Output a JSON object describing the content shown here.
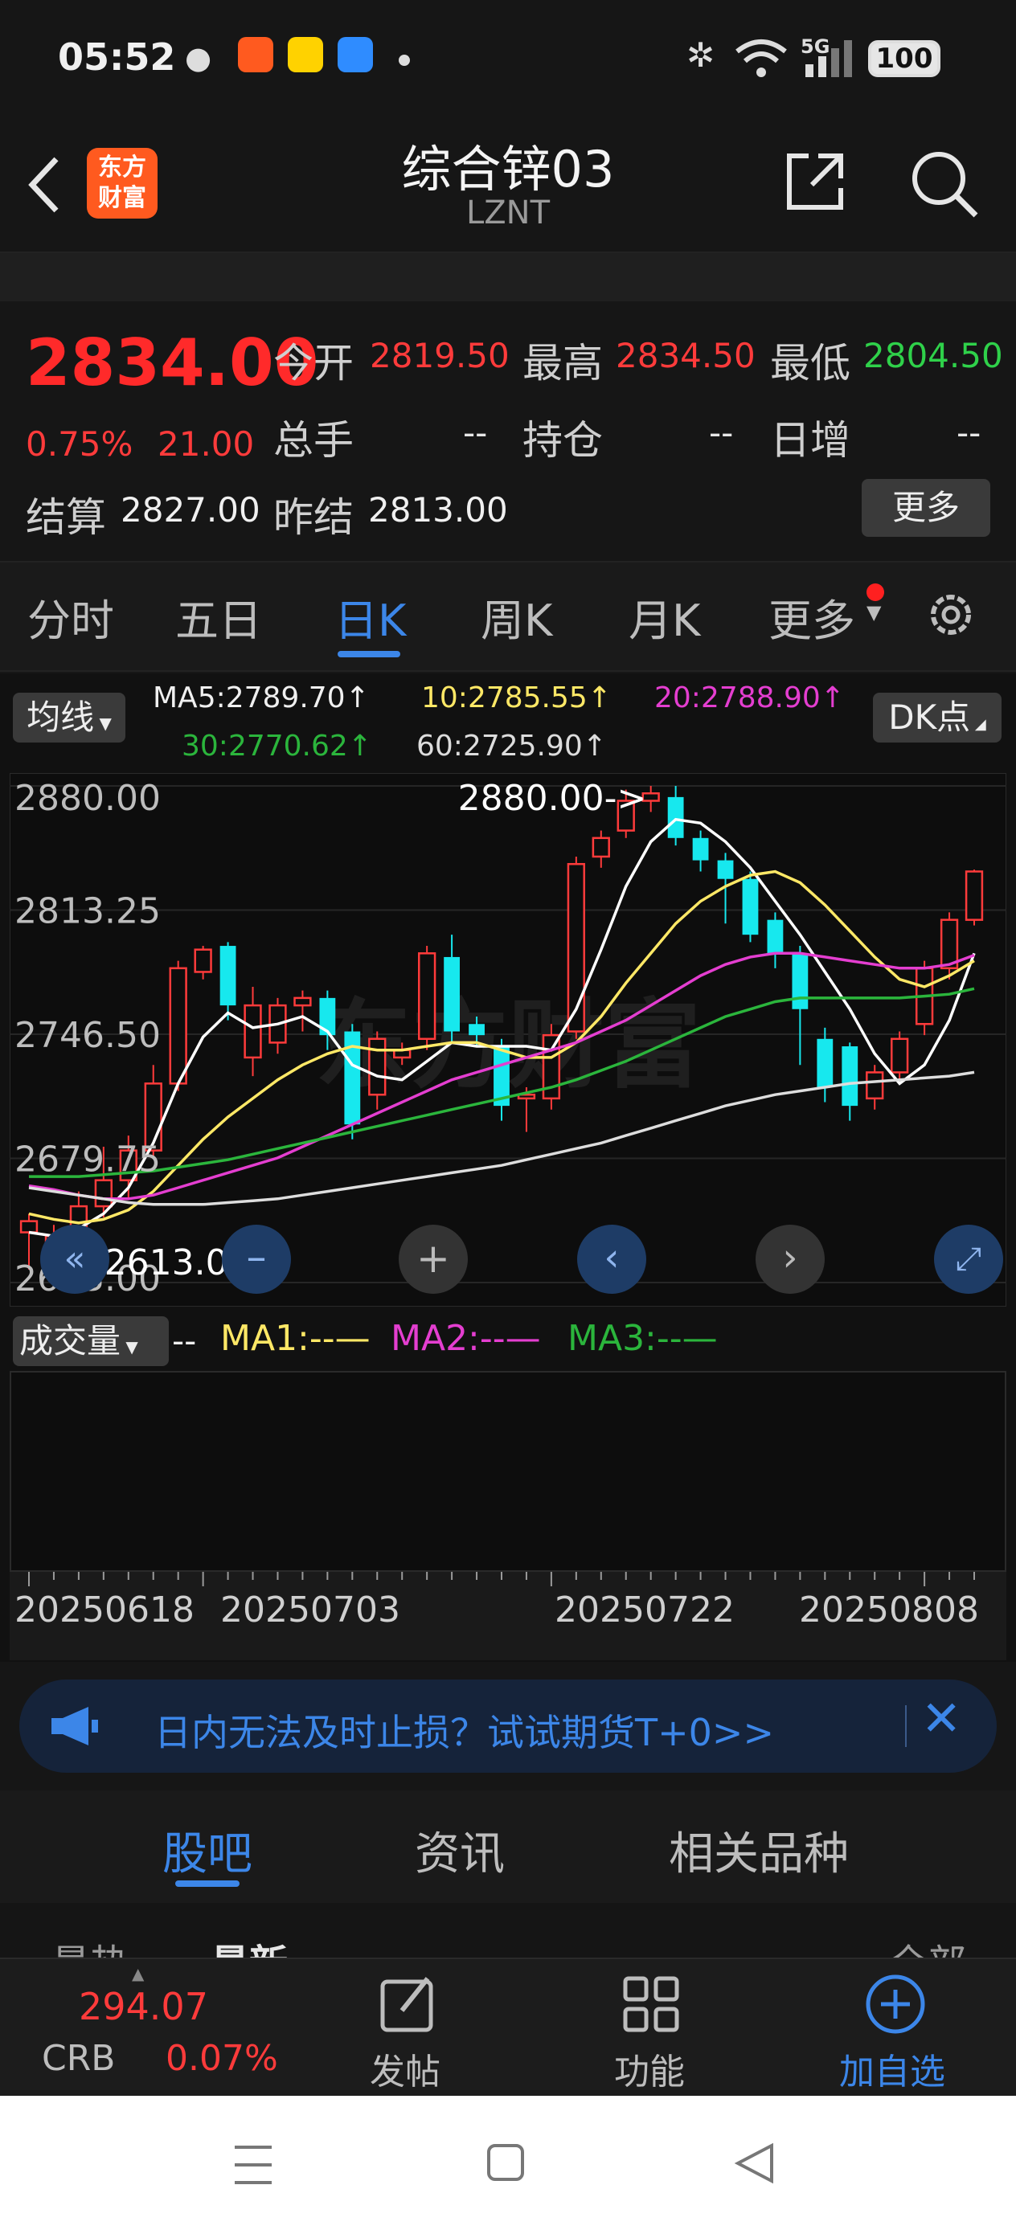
{
  "status": {
    "time": "05:52",
    "battery": "100",
    "network": "5G"
  },
  "header": {
    "title": "综合锌03",
    "subtitle": "LZNT",
    "logo_text": "东方财富"
  },
  "quote": {
    "price": "2834.00",
    "change_pct": "0.75%",
    "change": "21.00",
    "open_label": "今开",
    "open": "2819.50",
    "high_label": "最高",
    "high": "2834.50",
    "low_label": "最低",
    "low": "2804.50",
    "volume_label": "总手",
    "volume": "--",
    "oi_label": "持仓",
    "oi": "--",
    "daily_label": "日增",
    "daily": "--",
    "settle_label": "结算",
    "settle": "2827.00",
    "prev_settle_label": "昨结",
    "prev_settle": "2813.00",
    "more": "更多"
  },
  "tabs": [
    "分时",
    "五日",
    "日K",
    "周K",
    "月K",
    "更多"
  ],
  "active_tab": "日K",
  "indicators": {
    "ma_select": "均线",
    "ma5": "MA5:2789.70↑",
    "ma10": "10:2785.55↑",
    "ma20": "20:2788.90↑",
    "ma30": "30:2770.62↑",
    "ma60": "60:2725.90↑",
    "dk": "DK点"
  },
  "chart_data": {
    "type": "candlestick",
    "y_ticks": [
      "2880.00",
      "2813.25",
      "2746.50",
      "2679.75",
      "2613.00"
    ],
    "ylim": [
      2613,
      2880
    ],
    "x_labels": [
      "20250618",
      "20250703",
      "20250722",
      "20250808"
    ],
    "high_marker": "2880.00->",
    "low_marker": "<-2613.00",
    "candles": [
      [
        2640,
        2646,
        2620,
        2650
      ],
      [
        2622,
        2638,
        2616,
        2644
      ],
      [
        2636,
        2654,
        2630,
        2662
      ],
      [
        2654,
        2668,
        2648,
        2686
      ],
      [
        2668,
        2684,
        2658,
        2692
      ],
      [
        2684,
        2720,
        2680,
        2730
      ],
      [
        2720,
        2782,
        2716,
        2786
      ],
      [
        2780,
        2792,
        2776,
        2794
      ],
      [
        2794,
        2762,
        2754,
        2796
      ],
      [
        2734,
        2762,
        2724,
        2772
      ],
      [
        2742,
        2762,
        2736,
        2766
      ],
      [
        2762,
        2766,
        2748,
        2770
      ],
      [
        2766,
        2746,
        2738,
        2770
      ],
      [
        2748,
        2698,
        2690,
        2752
      ],
      [
        2714,
        2744,
        2706,
        2748
      ],
      [
        2734,
        2738,
        2730,
        2742
      ],
      [
        2744,
        2790,
        2738,
        2794
      ],
      [
        2788,
        2748,
        2742,
        2800
      ],
      [
        2752,
        2746,
        2740,
        2756
      ],
      [
        2740,
        2708,
        2700,
        2744
      ],
      [
        2712,
        2714,
        2694,
        2718
      ],
      [
        2712,
        2746,
        2706,
        2752
      ],
      [
        2748,
        2838,
        2744,
        2842
      ],
      [
        2842,
        2852,
        2836,
        2856
      ],
      [
        2856,
        2872,
        2852,
        2878
      ],
      [
        2872,
        2876,
        2866,
        2880
      ],
      [
        2874,
        2852,
        2848,
        2880
      ],
      [
        2852,
        2840,
        2834,
        2856
      ],
      [
        2840,
        2830,
        2806,
        2844
      ],
      [
        2830,
        2800,
        2796,
        2834
      ],
      [
        2808,
        2790,
        2782,
        2812
      ],
      [
        2790,
        2760,
        2730,
        2794
      ],
      [
        2744,
        2718,
        2710,
        2750
      ],
      [
        2740,
        2708,
        2700,
        2742
      ],
      [
        2712,
        2726,
        2706,
        2730
      ],
      [
        2726,
        2744,
        2722,
        2748
      ],
      [
        2752,
        2782,
        2746,
        2786
      ],
      [
        2782,
        2808,
        2776,
        2812
      ],
      [
        2808,
        2834,
        2805,
        2835
      ]
    ],
    "series": [
      {
        "name": "MA5",
        "color": "#ffffff",
        "values": [
          2640,
          2638,
          2642,
          2650,
          2664,
          2688,
          2720,
          2745,
          2758,
          2750,
          2752,
          2756,
          2748,
          2730,
          2724,
          2722,
          2732,
          2742,
          2740,
          2740,
          2740,
          2738,
          2760,
          2792,
          2826,
          2850,
          2862,
          2860,
          2850,
          2836,
          2818,
          2800,
          2780,
          2760,
          2736,
          2720,
          2730,
          2754,
          2790
        ]
      },
      {
        "name": "10",
        "color": "#ffe866",
        "values": [
          2650,
          2647,
          2645,
          2647,
          2652,
          2662,
          2676,
          2690,
          2702,
          2712,
          2722,
          2730,
          2736,
          2740,
          2738,
          2738,
          2740,
          2742,
          2742,
          2738,
          2734,
          2734,
          2742,
          2756,
          2774,
          2790,
          2806,
          2818,
          2826,
          2832,
          2834,
          2828,
          2816,
          2802,
          2788,
          2776,
          2772,
          2778,
          2786
        ]
      },
      {
        "name": "20",
        "color": "#e43ed0",
        "values": [
          2665,
          2663,
          2660,
          2658,
          2658,
          2660,
          2664,
          2668,
          2672,
          2676,
          2680,
          2686,
          2692,
          2698,
          2704,
          2710,
          2716,
          2722,
          2726,
          2730,
          2734,
          2738,
          2742,
          2748,
          2754,
          2762,
          2770,
          2778,
          2784,
          2788,
          2790,
          2790,
          2788,
          2786,
          2784,
          2782,
          2782,
          2784,
          2789
        ]
      },
      {
        "name": "30",
        "color": "#2bb53c",
        "values": [
          2670,
          2670,
          2670,
          2671,
          2672,
          2673,
          2675,
          2677,
          2679,
          2682,
          2685,
          2688,
          2691,
          2694,
          2697,
          2700,
          2703,
          2706,
          2709,
          2712,
          2715,
          2718,
          2722,
          2727,
          2732,
          2738,
          2744,
          2750,
          2756,
          2760,
          2764,
          2766,
          2766,
          2766,
          2766,
          2766,
          2767,
          2768,
          2771
        ]
      },
      {
        "name": "60",
        "color": "#dddddd",
        "values": [
          2664,
          2662,
          2660,
          2658,
          2656,
          2655,
          2655,
          2655,
          2656,
          2657,
          2658,
          2660,
          2662,
          2664,
          2666,
          2668,
          2670,
          2672,
          2674,
          2676,
          2679,
          2682,
          2685,
          2688,
          2692,
          2696,
          2700,
          2704,
          2708,
          2711,
          2714,
          2716,
          2718,
          2720,
          2721,
          2722,
          2723,
          2724,
          2726
        ]
      }
    ]
  },
  "volume": {
    "select": "成交量",
    "value": "--",
    "ma1": "MA1:--",
    "ma2": "MA2:--",
    "ma3": "MA3:--"
  },
  "banner": {
    "text": "日内无法及时止损？试试期货T+0>>"
  },
  "bottom_tabs": [
    "股吧",
    "资讯",
    "相关品种"
  ],
  "peek": {
    "left1": "最热",
    "left2": "最新",
    "right": "全部"
  },
  "toolbar": {
    "crb_value": "294.07",
    "crb_label": "CRB",
    "crb_change": "0.07%",
    "post": "发帖",
    "func": "功能",
    "add": "加自选"
  },
  "colors": {
    "up": "#ff3b3b",
    "down": "#17e8ee",
    "accent": "#3c86e8",
    "bg": "#111111"
  }
}
